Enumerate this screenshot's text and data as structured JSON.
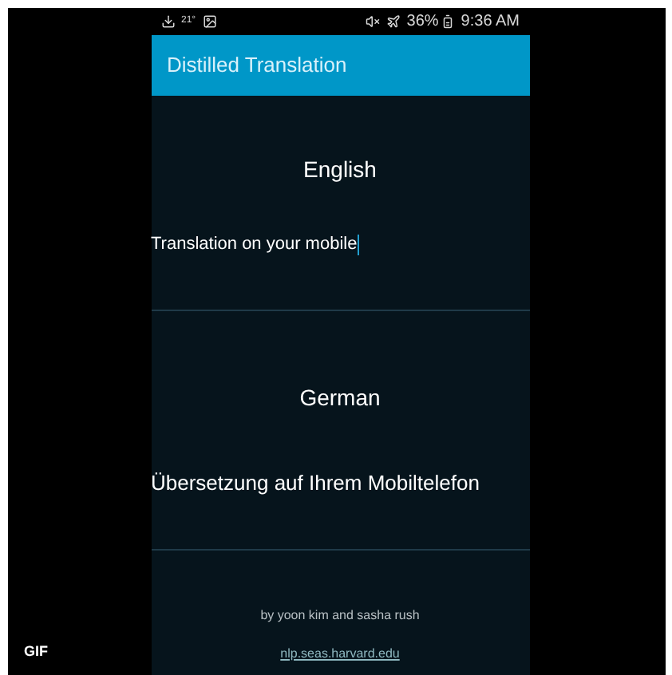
{
  "overlay_badge": "GIF",
  "status_bar": {
    "temperature": "21°",
    "battery": "36%",
    "time": "9:36 AM"
  },
  "app_bar": {
    "title": "Distilled Translation"
  },
  "source": {
    "language": "English",
    "value": "Translation on your mobile"
  },
  "target": {
    "language": "German",
    "text": "Übersetzung auf Ihrem Mobiltelefon"
  },
  "footer": {
    "credits": "by yoon kim and sasha rush",
    "link": "nlp.seas.harvard.edu"
  }
}
